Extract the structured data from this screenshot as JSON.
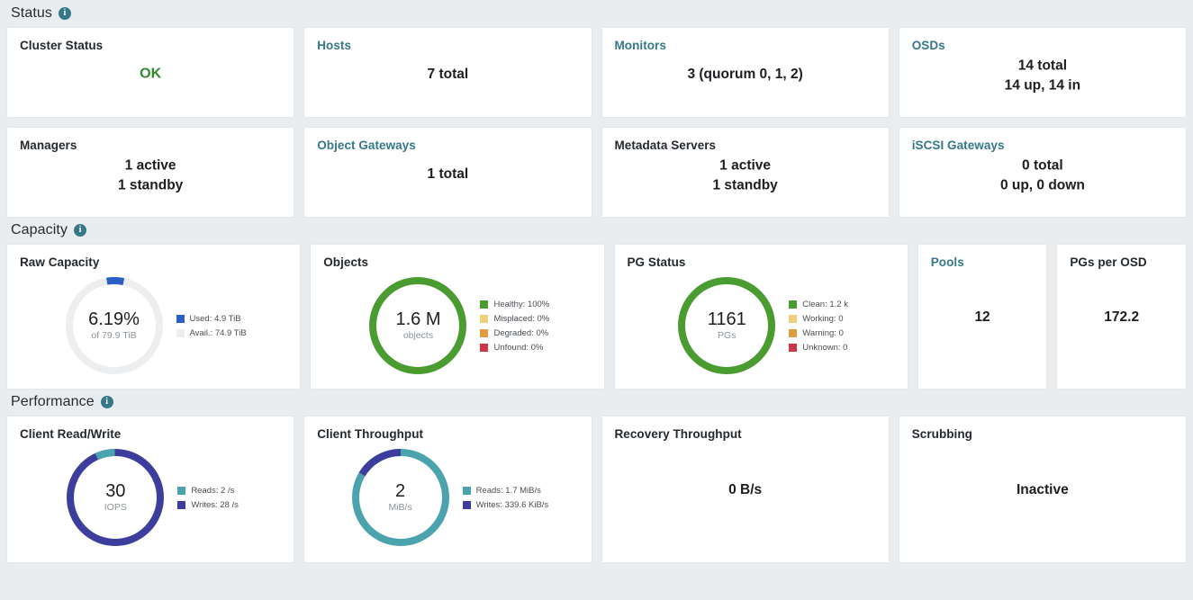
{
  "sections": {
    "status": {
      "title": "Status",
      "info_icon": "info-icon"
    },
    "capacity": {
      "title": "Capacity",
      "info_icon": "info-icon"
    },
    "performance": {
      "title": "Performance",
      "info_icon": "info-icon"
    }
  },
  "colors": {
    "ok_green": "#2f8a2f",
    "link_teal": "#35788a",
    "used_blue": "#2b5fc5",
    "avail_gray": "#eceef0",
    "healthy_green": "#4a9b30",
    "misplaced_yellow": "#f0d07a",
    "degraded_orange": "#e09b3d",
    "unfound_red": "#cc3647",
    "reads_teal": "#4ba3ad",
    "writes_purple": "#3d3d9e"
  },
  "status_cards": [
    {
      "title": "Cluster Status",
      "link": false,
      "value_lines": [
        "OK"
      ],
      "ok": true
    },
    {
      "title": "Hosts",
      "link": true,
      "value_lines": [
        "7 total"
      ],
      "ok": false
    },
    {
      "title": "Monitors",
      "link": true,
      "value_lines": [
        "3 (quorum 0, 1, 2)"
      ],
      "ok": false
    },
    {
      "title": "OSDs",
      "link": true,
      "value_lines": [
        "14 total",
        "14 up, 14 in"
      ],
      "ok": false
    },
    {
      "title": "Managers",
      "link": false,
      "value_lines": [
        "1 active",
        "1 standby"
      ],
      "ok": false
    },
    {
      "title": "Object Gateways",
      "link": true,
      "value_lines": [
        "1 total"
      ],
      "ok": false
    },
    {
      "title": "Metadata Servers",
      "link": false,
      "value_lines": [
        "1 active",
        "1 standby"
      ],
      "ok": false
    },
    {
      "title": "iSCSI Gateways",
      "link": true,
      "value_lines": [
        "0 total",
        "0 up, 0 down"
      ],
      "ok": false
    }
  ],
  "capacity": {
    "raw_capacity": {
      "title": "Raw Capacity",
      "center_main": "6.19%",
      "center_sub": "of 79.9 TiB",
      "legend": [
        {
          "label": "Used: 4.9 TiB",
          "color": "#2b5fc5"
        },
        {
          "label": "Avail.: 74.9 TiB",
          "color": "#eceef0"
        }
      ]
    },
    "objects": {
      "title": "Objects",
      "center_main": "1.6 M",
      "center_sub": "objects",
      "legend": [
        {
          "label": "Healthy: 100%",
          "color": "#4a9b30"
        },
        {
          "label": "Misplaced: 0%",
          "color": "#f0d07a"
        },
        {
          "label": "Degraded: 0%",
          "color": "#e09b3d"
        },
        {
          "label": "Unfound: 0%",
          "color": "#cc3647"
        }
      ]
    },
    "pg_status": {
      "title": "PG Status",
      "center_main": "1161",
      "center_sub": "PGs",
      "legend": [
        {
          "label": "Clean: 1.2 k",
          "color": "#4a9b30"
        },
        {
          "label": "Working: 0",
          "color": "#f0d07a"
        },
        {
          "label": "Warning: 0",
          "color": "#e09b3d"
        },
        {
          "label": "Unknown: 0",
          "color": "#cc3647"
        }
      ]
    },
    "pools": {
      "title": "Pools",
      "link": true,
      "value": "12"
    },
    "pgs_per_osd": {
      "title": "PGs per OSD",
      "link": false,
      "value": "172.2"
    }
  },
  "performance": {
    "client_read_write": {
      "title": "Client Read/Write",
      "center_main": "30",
      "center_sub": "IOPS",
      "legend": [
        {
          "label": "Reads: 2 /s",
          "color": "#4ba3ad"
        },
        {
          "label": "Writes: 28 /s",
          "color": "#3d3d9e"
        }
      ]
    },
    "client_throughput": {
      "title": "Client Throughput",
      "center_main": "2",
      "center_sub": "MiB/s",
      "legend": [
        {
          "label": "Reads: 1.7 MiB/s",
          "color": "#4ba3ad"
        },
        {
          "label": "Writes: 339.6 KiB/s",
          "color": "#3d3d9e"
        }
      ]
    },
    "recovery_throughput": {
      "title": "Recovery Throughput",
      "value": "0 B/s"
    },
    "scrubbing": {
      "title": "Scrubbing",
      "value": "Inactive"
    }
  },
  "chart_data": [
    {
      "type": "pie",
      "title": "Raw Capacity",
      "labels": [
        "Used",
        "Avail."
      ],
      "values": [
        4.9,
        74.9
      ],
      "unit": "TiB",
      "total": 79.9,
      "used_percent": 6.19,
      "colors": [
        "#2b5fc5",
        "#eceef0"
      ],
      "legend": "right"
    },
    {
      "type": "pie",
      "title": "Objects",
      "labels": [
        "Healthy",
        "Misplaced",
        "Degraded",
        "Unfound"
      ],
      "values": [
        100,
        0,
        0,
        0
      ],
      "unit": "%",
      "total_objects": "1.6 M",
      "colors": [
        "#4a9b30",
        "#f0d07a",
        "#e09b3d",
        "#cc3647"
      ],
      "legend": "right"
    },
    {
      "type": "pie",
      "title": "PG Status",
      "labels": [
        "Clean",
        "Working",
        "Warning",
        "Unknown"
      ],
      "values": [
        1161,
        0,
        0,
        0
      ],
      "unit": "PGs",
      "colors": [
        "#4a9b30",
        "#f0d07a",
        "#e09b3d",
        "#cc3647"
      ],
      "legend": "right"
    },
    {
      "type": "pie",
      "title": "Client Read/Write",
      "labels": [
        "Reads",
        "Writes"
      ],
      "values": [
        2,
        28
      ],
      "unit": "IOPS",
      "total": 30,
      "colors": [
        "#4ba3ad",
        "#3d3d9e"
      ],
      "legend": "right"
    },
    {
      "type": "pie",
      "title": "Client Throughput",
      "labels": [
        "Reads",
        "Writes"
      ],
      "values": [
        1.7,
        0.3316
      ],
      "unit": "MiB/s",
      "total": 2,
      "colors": [
        "#4ba3ad",
        "#3d3d9e"
      ],
      "legend": "right"
    }
  ]
}
